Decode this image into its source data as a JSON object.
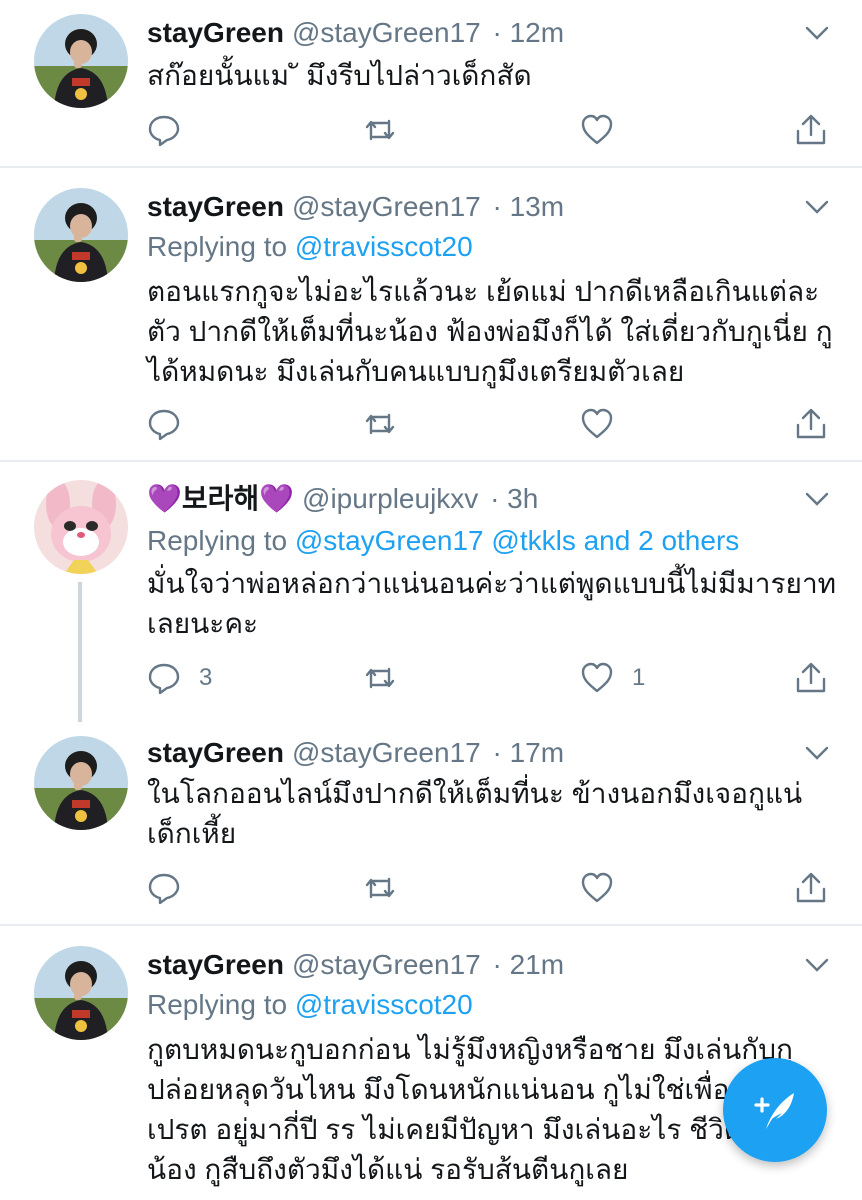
{
  "tweets": [
    {
      "name": "stayGreen",
      "handle": "@stayGreen17",
      "time": "· 12m",
      "text": "สก๊อยนั้นแม ั มึงรีบไปล่าวเด็กสัด",
      "reply_count": "",
      "like_count": ""
    },
    {
      "name": "stayGreen",
      "handle": "@stayGreen17",
      "time": "· 13m",
      "replying_prefix": "Replying to ",
      "replying_to": "@travisscot20",
      "text": "ตอนแรกกูจะไม่อะไรแล้วนะ เย้ดแม่ ปากดีเหลือเกินแต่ละตัว ปากดีให้เต็มที่นะน้อง ฟ้องพ่อมึงก็ได้ ใส่เดี่ยวกับกูเนี่ย กูได้หมดนะ มึงเล่นกับคนแบบกูมึงเตรียมตัวเลย"
    },
    {
      "name": "💜보라해💜",
      "handle": "@ipurpleujkxv",
      "time": "· 3h",
      "replying_prefix": "Replying to ",
      "replying_to": "@stayGreen17 @tkkls and 2 others",
      "text": "มั่นใจว่าพ่อหล่อกว่าแน่นอนค่ะว่าแต่พูดแบบนี้ไม่มีมารยาท เลยนะคะ",
      "reply_count": "3",
      "like_count": "1"
    },
    {
      "name": "stayGreen",
      "handle": "@stayGreen17",
      "time": "· 17m",
      "text": "ในโลกออนไลน์มึงปากดีให้เต็มที่นะ ข้างนอกมึงเจอกูแน่ เด็กเหี้ย"
    },
    {
      "name": "stayGreen",
      "handle": "@stayGreen17",
      "time": "· 21m",
      "replying_prefix": "Replying to ",
      "replying_to": "@travisscot20",
      "text": "กูตบหมดนะกูบอกก่อน ไม่รู้มึงหญิงหรือชาย มึงเล่นกับกู ปล่อยหลุดวันไหน มึงโดนหนักแน่นอน กูไม่ใช่เพื่อน เด็กเปรต อยู่มากี่ปี รร ไม่เคยมีปัญหา มึงเล่นอะไร ชีวิตจริงนะน้อง กูสืบถึงตัวมึงได้แน่ รอรับส้นตีนกูเลย"
    }
  ],
  "icons": {
    "reply": "reply-icon",
    "retweet": "retweet-icon",
    "like": "like-icon",
    "share": "share-icon",
    "caret": "chevron-down-icon",
    "compose": "compose-tweet-icon"
  },
  "colors": {
    "link": "#1da1f2",
    "secondary_text": "#657786",
    "fab": "#1da1f2"
  }
}
